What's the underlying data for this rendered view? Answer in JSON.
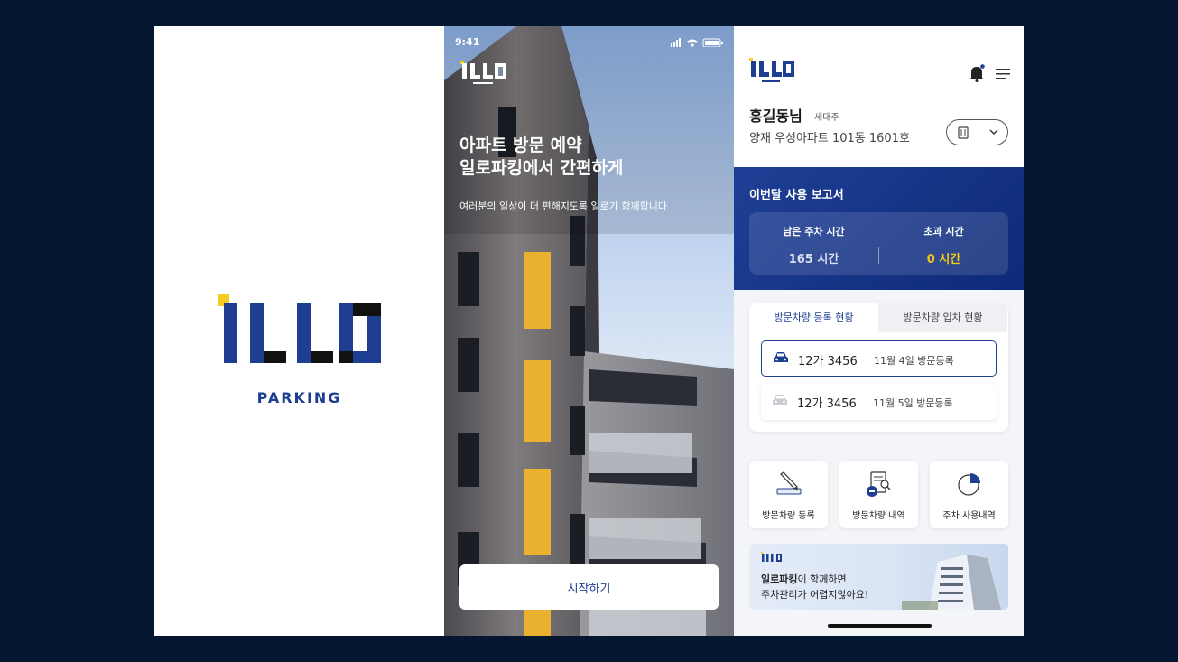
{
  "splash": {
    "logo_text": "ILLO",
    "tagline": "PARKING"
  },
  "onboarding": {
    "status_time": "9:41",
    "logo_text": "ILLO",
    "title": "아파트 방문 예약\n일로파킹에서 간편하게",
    "subtitle": "여러분의 일상이 더 편해지도록 일로가 함께합니다",
    "start_button": "시작하기"
  },
  "dashboard": {
    "logo_text": "ILLO",
    "user": {
      "name": "홍길동님",
      "role": "세대주",
      "address": "양재 우성아파트 101동 1601호"
    },
    "report": {
      "title": "이번달 사용 보고서",
      "remaining_label": "남은 주차 시간",
      "remaining_value": "165 시간",
      "over_label": "초과 시간",
      "over_value": "0 시간"
    },
    "tabs": [
      "방문차량 등록 현황",
      "방문차량 입차 현황"
    ],
    "vehicles": [
      {
        "plate": "12가 3456",
        "date": "11월 4일 방문등록"
      },
      {
        "plate": "12가 3456",
        "date": "11월 5일 방문등록"
      }
    ],
    "actions": [
      "방문차량 등록",
      "방문차량 내역",
      "주차 사용내역"
    ],
    "banner": {
      "logo_text": "ILLO",
      "line1_bold": "일로파킹",
      "line1_rest": "이 함께하면",
      "line2": "주차관리가 어렵지않아요!"
    }
  },
  "colors": {
    "background": "#051631",
    "brand_blue": "#1e3f91",
    "accent_yellow": "#f5c518",
    "report_blue": "#1f3f96"
  }
}
